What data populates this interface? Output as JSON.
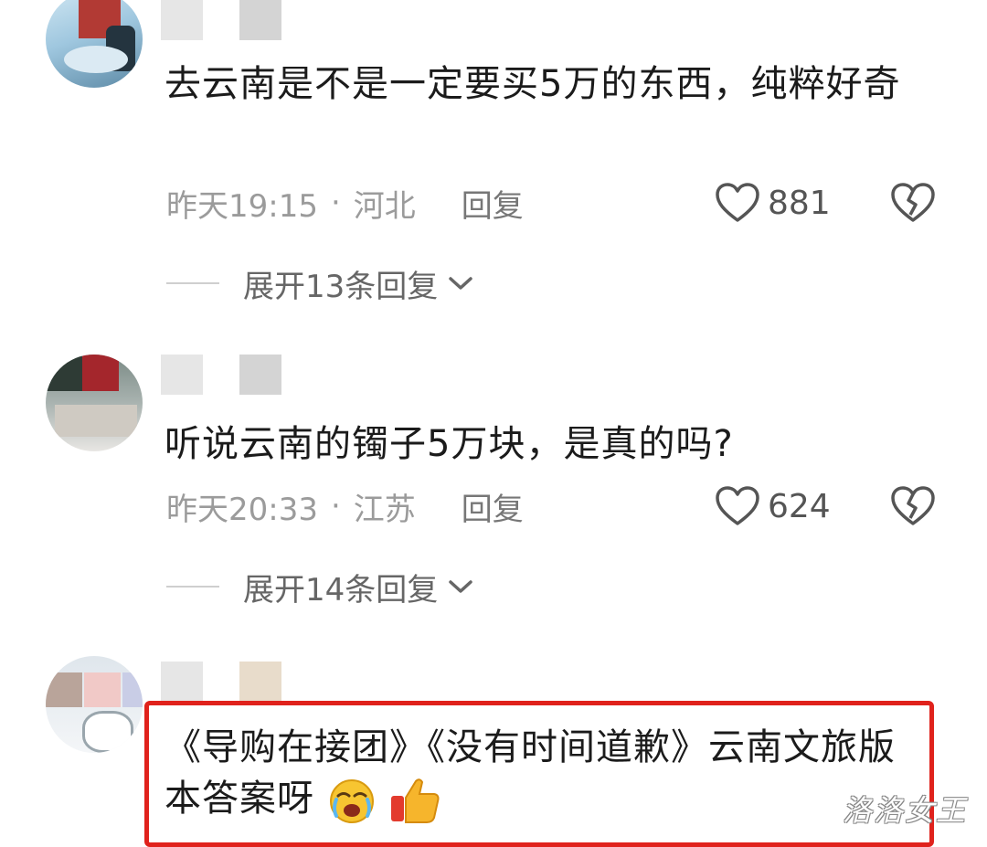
{
  "comments": [
    {
      "text": "去云南是不是一定要买5万的东西，纯粹好奇",
      "time": "昨天19:15",
      "separator": "·",
      "location": "河北",
      "reply_label": "回复",
      "likes": "881",
      "expand_label": "展开13条回复"
    },
    {
      "text": "听说云南的镯子5万块，是真的吗?",
      "time": "昨天20:33",
      "separator": "·",
      "location": "江苏",
      "reply_label": "回复",
      "likes": "624",
      "expand_label": "展开14条回复"
    },
    {
      "text": "《导购在接团》《没有时间道歉》云南文旅版本答案呀",
      "emojis": [
        "crying-face-icon",
        "thumbs-up-icon"
      ]
    }
  ],
  "watermark": "洛洛女王",
  "colors": {
    "highlight_border": "#e0221c",
    "meta_text": "#9b9b9b",
    "body_text": "#1b1b1b"
  }
}
